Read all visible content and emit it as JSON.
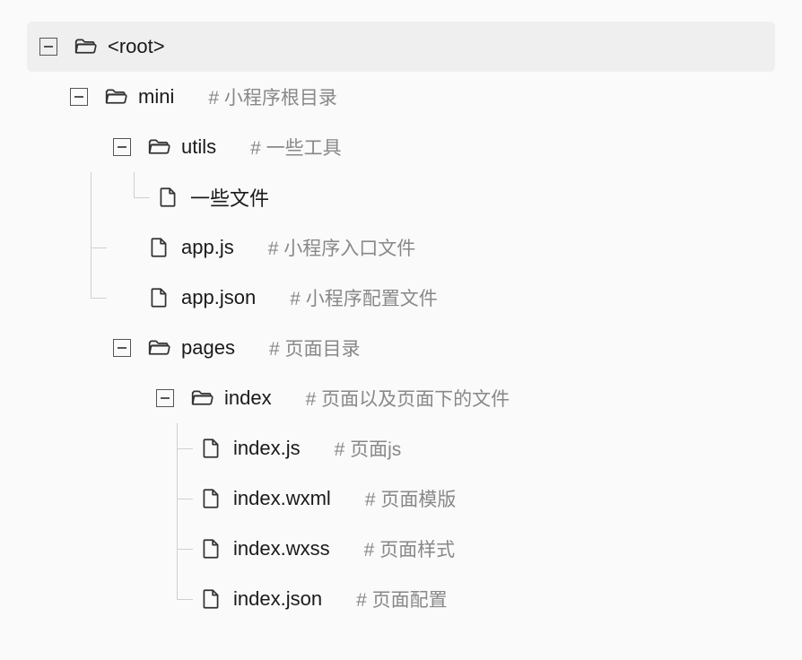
{
  "tree": {
    "root": {
      "name": "<root>",
      "comment": ""
    },
    "mini": {
      "name": "mini",
      "comment": "# 小程序根目录"
    },
    "utils": {
      "name": "utils",
      "comment": "# 一些工具"
    },
    "utils_file": {
      "name": "一些文件",
      "comment": ""
    },
    "app_js": {
      "name": "app.js",
      "comment": "# 小程序入口文件"
    },
    "app_json": {
      "name": "app.json",
      "comment": "# 小程序配置文件"
    },
    "pages": {
      "name": "pages",
      "comment": "# 页面目录"
    },
    "index_dir": {
      "name": "index",
      "comment": "# 页面以及页面下的文件"
    },
    "index_js": {
      "name": "index.js",
      "comment": "# 页面js"
    },
    "index_wxml": {
      "name": "index.wxml",
      "comment": "# 页面模版"
    },
    "index_wxss": {
      "name": "index.wxss",
      "comment": "# 页面样式"
    },
    "index_json": {
      "name": "index.json",
      "comment": "# 页面配置"
    }
  }
}
